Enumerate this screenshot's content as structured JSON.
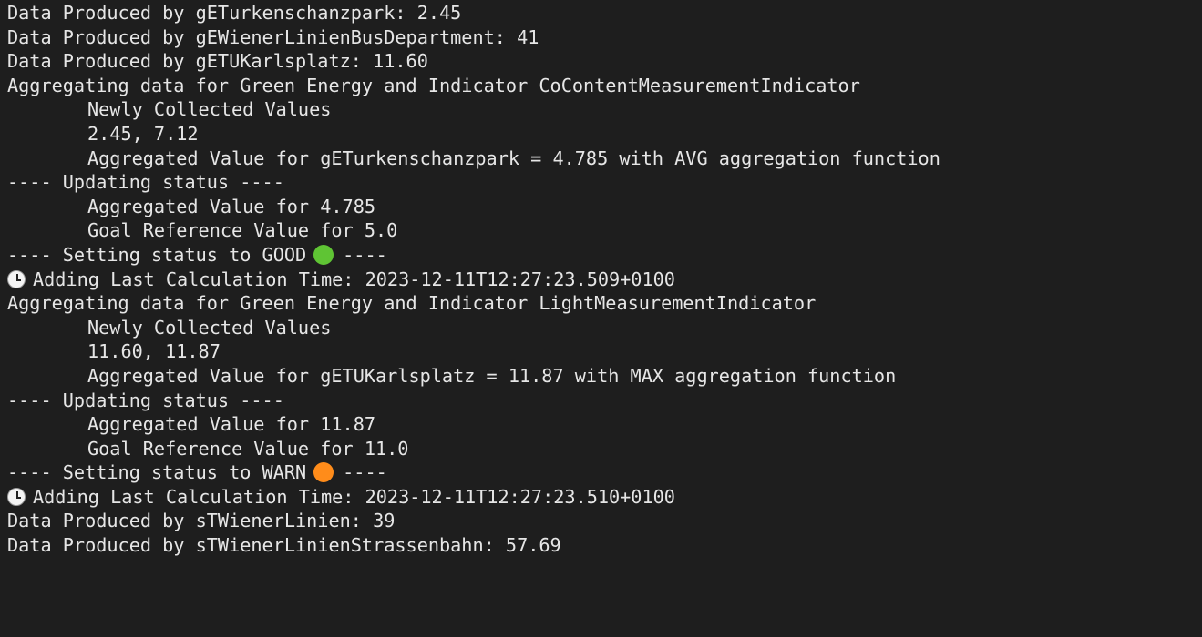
{
  "terminal": {
    "background": "#1e1e1e",
    "text_color": "#e6e6e6",
    "lines": {
      "l1": "Data Produced by gETurkenschanzpark: 2.45",
      "l2": "Data Produced by gEWienerLinienBusDepartment: 41",
      "l3": "Data Produced by gETUKarlsplatz: 11.60",
      "l4": "Aggregating data for Green Energy and Indicator CoContentMeasurementIndicator",
      "l5": "Newly Collected Values",
      "l6": "2.45, 7.12",
      "l7": "Aggregated Value for gETurkenschanzpark = 4.785 with AVG aggregation function",
      "l8": "---- Updating status ----",
      "l9": "Aggregated Value for 4.785",
      "l10": "Goal Reference Value for 5.0",
      "l11_prefix": "---- Setting status to GOOD",
      "l11_suffix": "----",
      "l11_icon": "green-circle-icon",
      "l12_icon": "clock-icon",
      "l12": "Adding Last Calculation Time: 2023-12-11T12:27:23.509+0100",
      "l13": "Aggregating data for Green Energy and Indicator LightMeasurementIndicator",
      "l14": "Newly Collected Values",
      "l15": "11.60, 11.87",
      "l16": "Aggregated Value for gETUKarlsplatz = 11.87 with MAX aggregation function",
      "l17": "---- Updating status ----",
      "l18": "Aggregated Value for 11.87",
      "l19": "Goal Reference Value for 11.0",
      "l20_prefix": "---- Setting status to WARN",
      "l20_suffix": "----",
      "l20_icon": "orange-circle-icon",
      "l21_icon": "clock-icon",
      "l21": "Adding Last Calculation Time: 2023-12-11T12:27:23.510+0100",
      "l22": "Data Produced by sTWienerLinien: 39",
      "l23": "Data Produced by sTWienerLinienStrassenbahn: 57.69"
    },
    "status_colors": {
      "good": "#5fc434",
      "warn": "#ff8c1a"
    }
  }
}
